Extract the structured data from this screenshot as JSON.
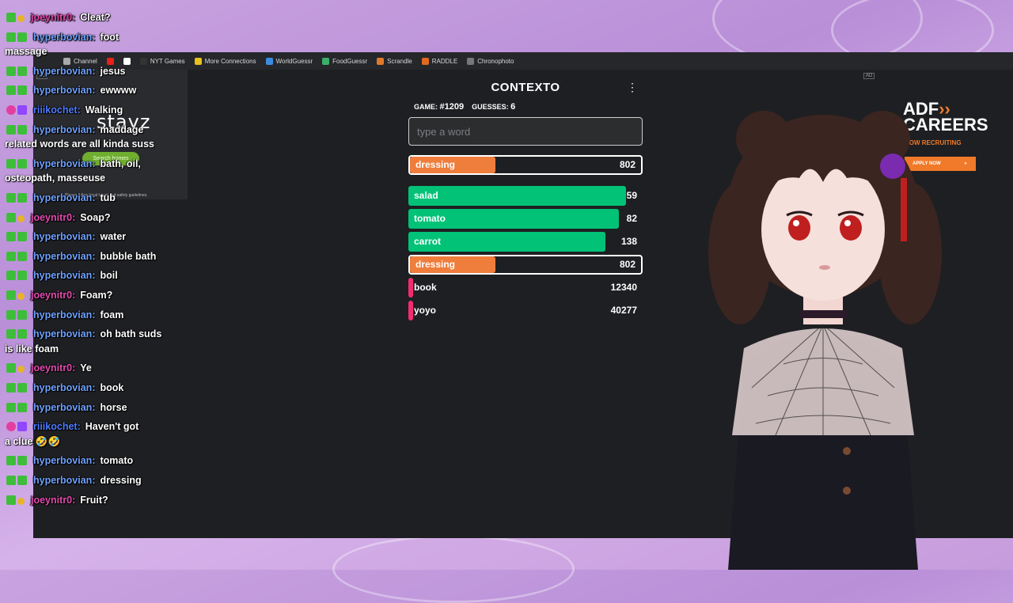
{
  "browser": {
    "bookmarks": [
      {
        "label": "Channel",
        "icon": "folder-icon"
      },
      {
        "label": "",
        "icon": "youtube-icon"
      },
      {
        "label": "",
        "icon": "x-icon"
      },
      {
        "label": "NYT Games",
        "icon": "nyt-icon"
      },
      {
        "label": "More Connections",
        "icon": "grid-icon"
      },
      {
        "label": "WorldGuessr",
        "icon": "globe-icon"
      },
      {
        "label": "FoodGuessr",
        "icon": "food-icon"
      },
      {
        "label": "Scrandle",
        "icon": "scrandle-icon"
      },
      {
        "label": "RADDLE",
        "icon": "raddle-icon"
      },
      {
        "label": "Chronophoto",
        "icon": "camera-icon"
      }
    ]
  },
  "ads": {
    "left": {
      "brand": "stayz",
      "button": "Search homes",
      "fine_print": "Please follow local travel and safety guidelines.",
      "tag": "AD"
    },
    "right": {
      "title_line1": "ADF",
      "title_line2": "CAREERS",
      "recruit": "NOW RECRUITING",
      "apply": "APPLY NOW",
      "tag": "AD"
    }
  },
  "contexto": {
    "title": "CONTEXTO",
    "game_label": "GAME:",
    "game_value": "#1209",
    "guesses_label": "GUESSES:",
    "guesses_value": "6",
    "input_placeholder": "type a word",
    "last_guess": {
      "word": "dressing",
      "distance": "802",
      "fill": 0.37,
      "color": "#ef7d3c"
    },
    "guesses": [
      {
        "word": "salad",
        "distance": "59",
        "fill": 0.93,
        "color": "#01c277",
        "highlight": false
      },
      {
        "word": "tomato",
        "distance": "82",
        "fill": 0.9,
        "color": "#01c277",
        "highlight": false
      },
      {
        "word": "carrot",
        "distance": "138",
        "fill": 0.84,
        "color": "#01c277",
        "highlight": false
      },
      {
        "word": "dressing",
        "distance": "802",
        "fill": 0.37,
        "color": "#ef7d3c",
        "highlight": true
      },
      {
        "word": "book",
        "distance": "12340",
        "fill": 0.02,
        "color": "#f42c6f",
        "highlight": false
      },
      {
        "word": "yoyo",
        "distance": "40277",
        "fill": 0.02,
        "color": "#f42c6f",
        "highlight": false
      }
    ]
  },
  "chat": [
    {
      "user": "joeynitr0:",
      "text": "Cleat?",
      "cls": "u-joey",
      "badge": "gold"
    },
    {
      "user": "hyperbovian:",
      "text": "foot",
      "cls": "u-hyper",
      "badge": "mod",
      "cont": "massage"
    },
    {
      "user": "hyperbovian:",
      "text": "jesus",
      "cls": "u-hyper",
      "badge": "mod"
    },
    {
      "user": "hyperbovian:",
      "text": "ewwww",
      "cls": "u-hyper",
      "badge": "mod"
    },
    {
      "user": "riiikochet:",
      "text": "Walking",
      "cls": "u-riil",
      "badge": "pink"
    },
    {
      "user": "hyperbovian:",
      "text": "maddage",
      "cls": "u-hyper",
      "badge": "mod",
      "cont": "related words are all kinda suss"
    },
    {
      "user": "hyperbovian:",
      "text": "bath, oil,",
      "cls": "u-hyper",
      "badge": "mod",
      "cont": "osteopath, masseuse"
    },
    {
      "user": "hyperbovian:",
      "text": "tub",
      "cls": "u-hyper",
      "badge": "mod"
    },
    {
      "user": "joeynitr0:",
      "text": "Soap?",
      "cls": "u-joey",
      "badge": "gold"
    },
    {
      "user": "hyperbovian:",
      "text": "water",
      "cls": "u-hyper",
      "badge": "mod"
    },
    {
      "user": "hyperbovian:",
      "text": "bubble bath",
      "cls": "u-hyper",
      "badge": "mod"
    },
    {
      "user": "hyperbovian:",
      "text": "boil",
      "cls": "u-hyper",
      "badge": "mod"
    },
    {
      "user": "joeynitr0:",
      "text": "Foam?",
      "cls": "u-joey",
      "badge": "gold"
    },
    {
      "user": "hyperbovian:",
      "text": "foam",
      "cls": "u-hyper",
      "badge": "mod"
    },
    {
      "user": "hyperbovian:",
      "text": "oh bath suds",
      "cls": "u-hyper",
      "badge": "mod",
      "cont": "is like foam"
    },
    {
      "user": "joeynitr0:",
      "text": "Ye",
      "cls": "u-joey",
      "badge": "gold"
    },
    {
      "user": "hyperbovian:",
      "text": "book",
      "cls": "u-hyper",
      "badge": "mod"
    },
    {
      "user": "hyperbovian:",
      "text": "horse",
      "cls": "u-hyper",
      "badge": "mod"
    },
    {
      "user": "riiikochet:",
      "text": "Haven't got",
      "cls": "u-riil",
      "badge": "pink",
      "cont": "a clue 🤣🤣"
    },
    {
      "user": "hyperbovian:",
      "text": "tomato",
      "cls": "u-hyper",
      "badge": "mod"
    },
    {
      "user": "hyperbovian:",
      "text": "dressing",
      "cls": "u-hyper",
      "badge": "mod"
    },
    {
      "user": "joeynitr0:",
      "text": "Fruit?",
      "cls": "u-joey",
      "badge": "gold"
    }
  ]
}
